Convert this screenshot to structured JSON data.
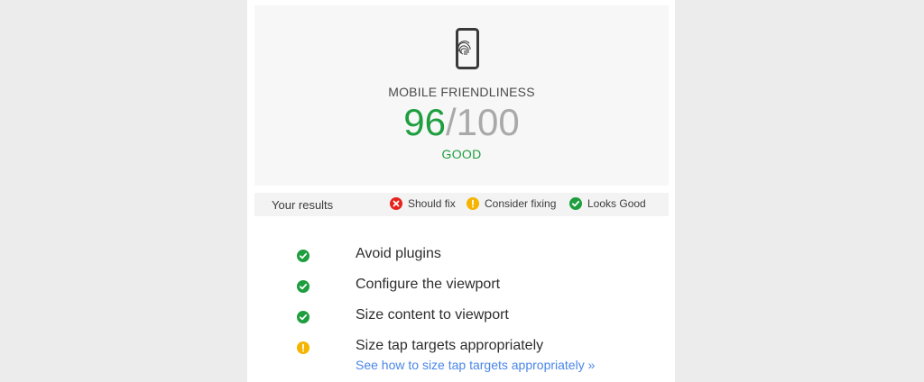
{
  "score": {
    "title": "MOBILE FRIENDLINESS",
    "value": "96",
    "separator": "/",
    "max": "100",
    "rating": "GOOD",
    "icon": "mobile-fingerprint-icon",
    "colors": {
      "good": "#1e9e3f",
      "muted": "#a9a9a9"
    }
  },
  "legend": {
    "label": "Your results",
    "items": [
      {
        "label": "Should fix",
        "icon": "x-circle-icon",
        "color": "#e5231d"
      },
      {
        "label": "Consider fixing",
        "icon": "exclamation-circle-icon",
        "color": "#f5b400"
      },
      {
        "label": "Looks Good",
        "icon": "check-circle-icon",
        "color": "#1e9e3f"
      }
    ]
  },
  "results": [
    {
      "name": "Avoid plugins",
      "status": "good",
      "icon": "check-circle-icon"
    },
    {
      "name": "Configure the viewport",
      "status": "good",
      "icon": "check-circle-icon"
    },
    {
      "name": "Size content to viewport",
      "status": "good",
      "icon": "check-circle-icon"
    },
    {
      "name": "Size tap targets appropriately",
      "status": "consider",
      "icon": "exclamation-circle-icon"
    }
  ],
  "help_link": "See how to size tap targets appropriately »"
}
